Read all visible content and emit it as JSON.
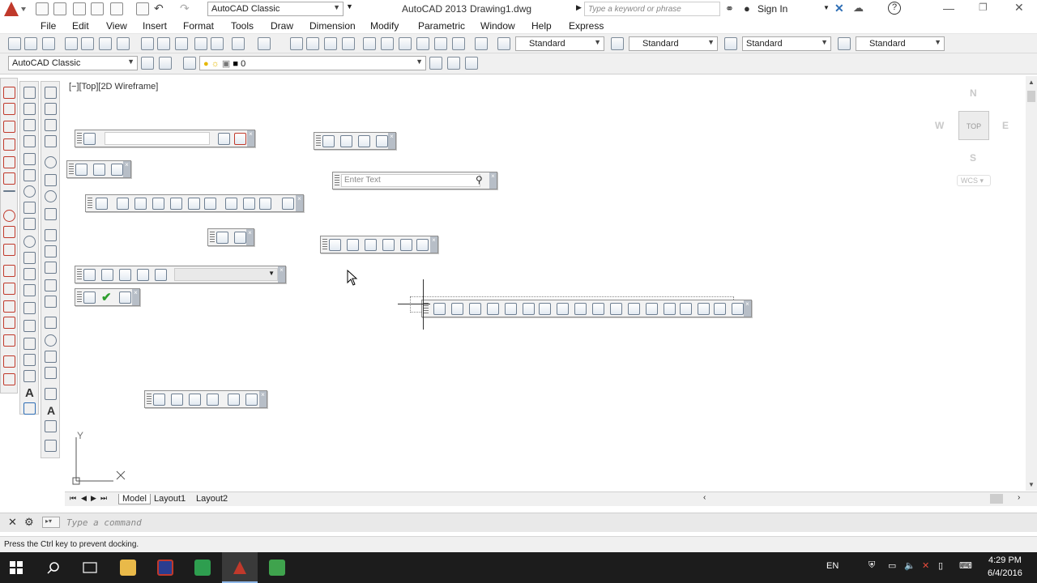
{
  "titlebar": {
    "workspace": "AutoCAD Classic",
    "app_title": "AutoCAD 2013",
    "doc_title": "Drawing1.dwg",
    "search_placeholder": "Type a keyword or phrase",
    "sign_in": "Sign In"
  },
  "menu": [
    "File",
    "Edit",
    "View",
    "Insert",
    "Format",
    "Tools",
    "Draw",
    "Dimension",
    "Modify",
    "Parametric",
    "Window",
    "Help",
    "Express"
  ],
  "styles": [
    "Standard",
    "Standard",
    "Standard",
    "Standard"
  ],
  "toolbar2": {
    "workspace": "AutoCAD Classic",
    "layer": "0"
  },
  "viewport": {
    "label": "[−][Top][2D Wireframe]"
  },
  "viewcube": {
    "face": "TOP",
    "north": "N",
    "south": "S",
    "east": "E",
    "west": "W",
    "wcs": "WCS"
  },
  "floating": {
    "search_placeholder": "Enter Text"
  },
  "ucs": {
    "y": "Y"
  },
  "layout_tabs": [
    "Model",
    "Layout1",
    "Layout2"
  ],
  "command": {
    "placeholder": "Type a command"
  },
  "status": {
    "message": "Press the Ctrl key to prevent docking."
  },
  "taskbar": {
    "lang": "EN",
    "time": "4:29 PM",
    "date": "6/4/2016"
  },
  "colors": {
    "accent": "#c0392b",
    "taskbar": "#1c1c1c"
  }
}
